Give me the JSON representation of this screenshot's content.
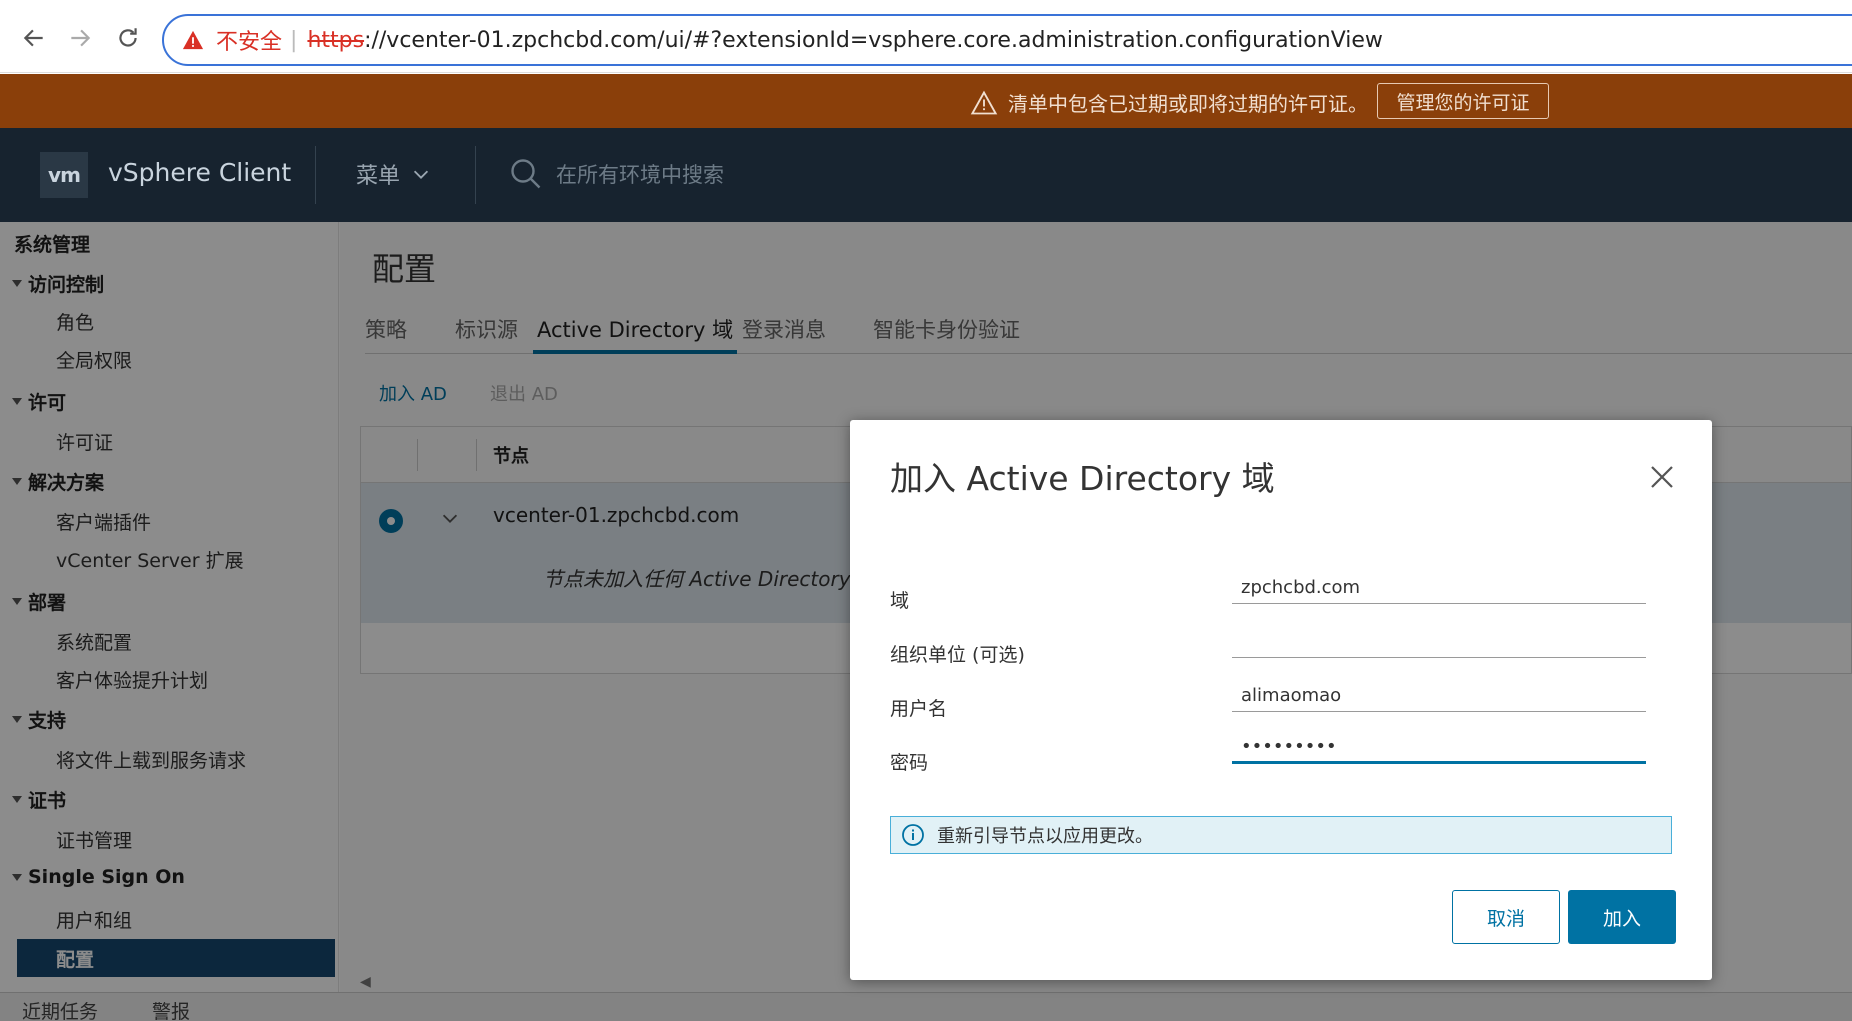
{
  "browser": {
    "insecure_label": "不安全",
    "url_scheme": "https",
    "url_rest": "://vcenter-01.zpchcbd.com/ui/#?extensionId=vsphere.core.administration.configurationView"
  },
  "banner": {
    "message": "清单中包含已过期或即将过期的许可证。",
    "button": "管理您的许可证"
  },
  "header": {
    "logo": "vm",
    "app_title": "vSphere Client",
    "menu_label": "菜单",
    "search_placeholder": "在所有环境中搜索"
  },
  "sidebar": {
    "title": "系统管理",
    "groups": [
      {
        "label": "访问控制",
        "items": [
          "角色",
          "全局权限"
        ]
      },
      {
        "label": "许可",
        "items": [
          "许可证"
        ]
      },
      {
        "label": "解决方案",
        "items": [
          "客户端插件",
          "vCenter Server 扩展"
        ]
      },
      {
        "label": "部署",
        "items": [
          "系统配置",
          "客户体验提升计划"
        ]
      },
      {
        "label": "支持",
        "items": [
          "将文件上载到服务请求"
        ]
      },
      {
        "label": "证书",
        "items": [
          "证书管理"
        ]
      },
      {
        "label": "Single Sign On",
        "items": [
          "用户和组",
          "配置"
        ]
      }
    ]
  },
  "main": {
    "page_title": "配置",
    "tabs": [
      "策略",
      "标识源",
      "Active Directory 域",
      "登录消息",
      "智能卡身份验证"
    ],
    "active_tab": "Active Directory 域",
    "actions": {
      "join": "加入 AD",
      "leave": "退出 AD"
    },
    "grid": {
      "column_node": "节点",
      "row_host": "vcenter-01.zpchcbd.com",
      "row_note": "节点未加入任何 Active Directory。"
    }
  },
  "bottom": {
    "tab1": "近期任务",
    "tab2": "警报"
  },
  "modal": {
    "title": "加入 Active Directory 域",
    "fields": [
      {
        "label": "域",
        "value": "zpchcbd.com"
      },
      {
        "label": "组织单位 (可选)",
        "value": ""
      },
      {
        "label": "用户名",
        "value": "alimaomao"
      },
      {
        "label": "密码",
        "value": "•••••••••"
      }
    ],
    "info": "重新引导节点以应用更改。",
    "cancel": "取消",
    "join": "加入"
  },
  "colors": {
    "banner_bg": "#8a3f0a",
    "header_bg": "#17232f",
    "accent": "#0072a3",
    "sidebar_active": "#17476f"
  }
}
